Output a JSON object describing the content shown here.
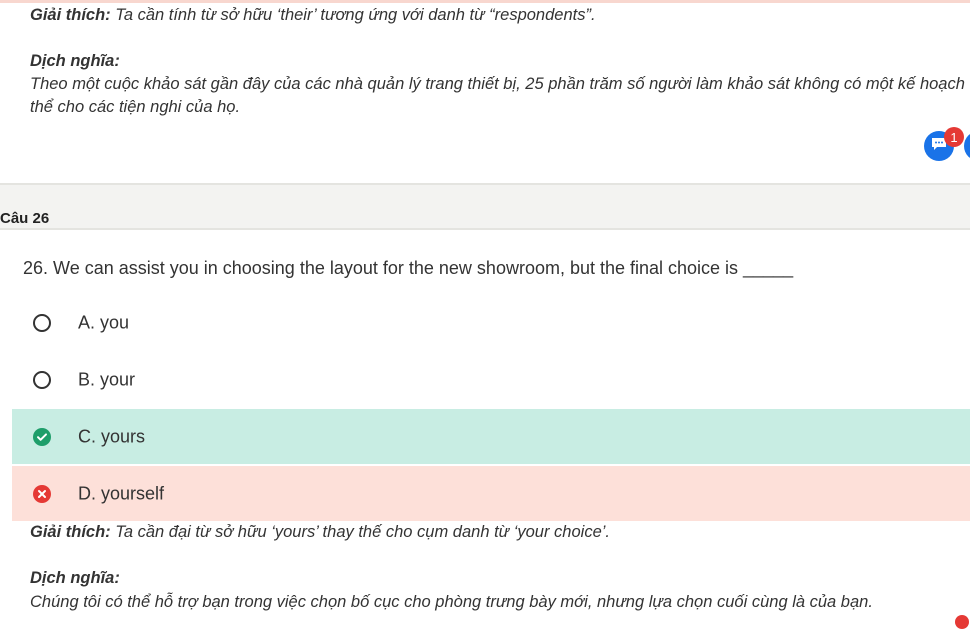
{
  "prev_question": {
    "explanation_label": "Giải thích:",
    "explanation_text": " Ta cần tính từ sở hữu ‘their’ tương ứng với danh từ “respondents”.",
    "translation_label": "Dịch nghĩa:",
    "translation_line1": "Theo một cuộc khảo sát gần đây của các nhà quản lý trang thiết bị, 25 phần trăm số người làm khảo sát không có một kế hoạch",
    "translation_line2": "thể cho các tiện nghi của họ."
  },
  "chat": {
    "badge_count": "1"
  },
  "question": {
    "section_title": "Câu 26",
    "text": "26. We can assist you in choosing the layout for the new showroom, but the final choice is _____",
    "options": [
      {
        "label": "A. you",
        "state": "default"
      },
      {
        "label": "B. your",
        "state": "default"
      },
      {
        "label": "C. yours",
        "state": "correct"
      },
      {
        "label": "D. yourself",
        "state": "wrong"
      }
    ],
    "explanation_label": "Giải thích:",
    "explanation_text": " Ta cần đại từ sở hữu ‘yours’ thay thế cho cụm danh từ ‘your choice’.",
    "translation_label": "Dịch nghĩa:",
    "translation_text": "Chúng tôi có thể hỗ trợ bạn trong việc chọn bố cục cho phòng trưng bày mới, nhưng lựa chọn cuối cùng là của bạn."
  },
  "colors": {
    "correct_bg": "#c8ede3",
    "wrong_bg": "#fde0d9",
    "correct_icon": "#1e9e6a",
    "wrong_icon": "#e53935",
    "accent": "#1a73e8"
  }
}
